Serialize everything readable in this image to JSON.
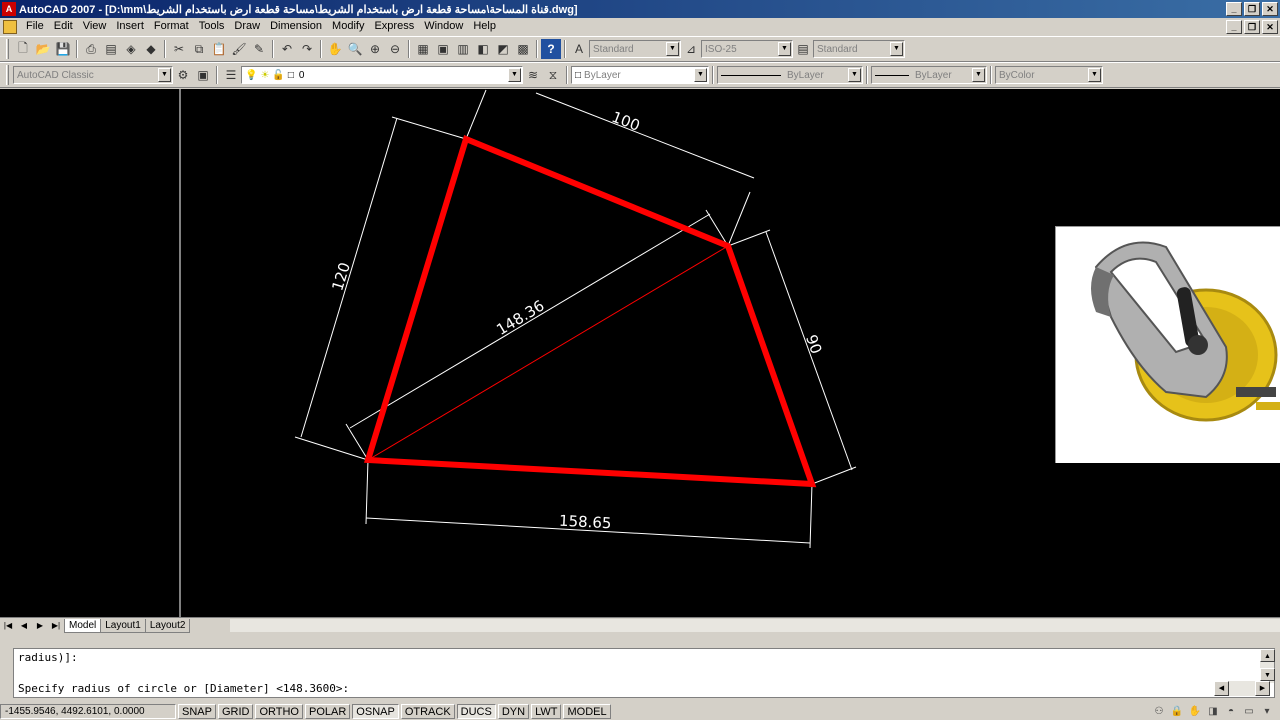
{
  "window": {
    "title": "AutoCAD 2007 - [D:\\mm\\قناة المساحة\\مساحة قطعة ارض باستخدام الشريط\\مساحة قطعة ارض باستخدام الشريط.dwg]",
    "minimize": "_",
    "restore": "❐",
    "close": "✕"
  },
  "menu": [
    "File",
    "Edit",
    "View",
    "Insert",
    "Format",
    "Tools",
    "Draw",
    "Dimension",
    "Modify",
    "Express",
    "Window",
    "Help"
  ],
  "toolbar1": {
    "text_style": "Standard",
    "dim_style": "ISO-25",
    "table_style": "Standard"
  },
  "toolbar2": {
    "workspace": "AutoCAD Classic",
    "layer": "0",
    "color": "ByLayer",
    "linetype": "ByLayer",
    "lineweight": "ByLayer",
    "plotstyle": "ByColor"
  },
  "drawing": {
    "dimensions": {
      "top": "100",
      "left": "120",
      "right": "90",
      "diagonal": "148.36",
      "bottom": "158.65"
    },
    "colors": {
      "background": "#000000",
      "polygon": "#ff0000",
      "dims": "#ffffff",
      "diagonal": "#ff0000"
    }
  },
  "tabs": [
    "Model",
    "Layout1",
    "Layout2"
  ],
  "command": {
    "line1": "radius)]:",
    "line2": "Specify radius of circle or [Diameter] <148.3600>:"
  },
  "status": {
    "coords": "-1455.9546, 4492.6101, 0.0000",
    "toggles": [
      "SNAP",
      "GRID",
      "ORTHO",
      "POLAR",
      "OSNAP",
      "OTRACK",
      "DUCS",
      "DYN",
      "LWT",
      "MODEL"
    ]
  }
}
